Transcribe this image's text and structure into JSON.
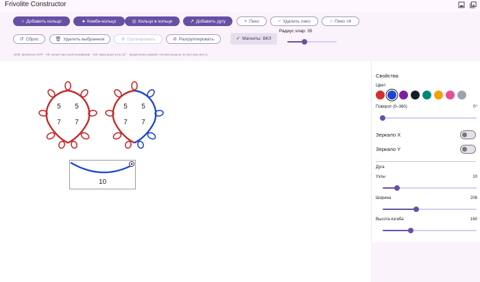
{
  "app": {
    "title": "Frivolite Constructor"
  },
  "window_icons": [
    "image-icon",
    "gallery-icon"
  ],
  "toolbar": {
    "row1": [
      {
        "id": "add-ring",
        "label": "Добавить кольцо",
        "icon": "circle-icon",
        "glyph": "○",
        "style": "filled"
      },
      {
        "id": "combo-ring",
        "label": "Комби-кольцо",
        "icon": "filled-circle-icon",
        "glyph": "●",
        "style": "filled"
      },
      {
        "id": "ring-in-ring",
        "label": "Кольцо в кольце",
        "icon": "ring-in-ring-icon",
        "glyph": "◎",
        "style": "filled"
      },
      {
        "id": "add-arc",
        "label": "Добавить дугу",
        "icon": "trend-icon",
        "glyph": "↗",
        "style": "filled"
      },
      {
        "id": "picot",
        "label": "Пико",
        "icon": "plus-icon",
        "glyph": "+",
        "style": "outlined"
      },
      {
        "id": "remove-picot",
        "label": "Удалить пико",
        "icon": "minus-icon",
        "glyph": "−",
        "style": "outlined"
      },
      {
        "id": "picot-x8",
        "label": "Пико ×8",
        "icon": "circle-clock-icon",
        "glyph": "○",
        "style": "outlined"
      }
    ],
    "row2": [
      {
        "id": "reset",
        "label": "Сброс",
        "icon": "reset-icon",
        "glyph": "↺",
        "style": "outlined"
      },
      {
        "id": "delete-selected",
        "label": "Удалить выбранное",
        "icon": "trash-icon",
        "glyph": "🗑",
        "style": "outlined"
      },
      {
        "id": "group",
        "label": "Группировать",
        "icon": "group-icon",
        "glyph": "⊕",
        "style": "disabled"
      },
      {
        "id": "ungroup",
        "label": "Разгруппировать",
        "icon": "ungroup-icon",
        "glyph": "⊘",
        "style": "outlined"
      },
      {
        "id": "magnets",
        "label": "Магниты: ВКЛ",
        "icon": "check-icon",
        "glyph": "✓",
        "style": "tonal"
      }
    ],
    "snap_label": "Радиус snap: 35",
    "snap_value": 0.35,
    "hint": "Shift: временно OFF  ·  Alt: копия при перетаскивании  ·  Ctrl: фиксация угла 15°  ·  Выделение рамкой: потяни мышью по пустому месту"
  },
  "canvas": {
    "rings": [
      {
        "id": "ring-left",
        "color": "#c62828",
        "numbers": [
          "5",
          "5",
          "7",
          "7"
        ]
      },
      {
        "id": "ring-right",
        "color": "#c62828",
        "accent": "#1e44d4",
        "numbers": [
          "5",
          "5",
          "7",
          "7"
        ]
      }
    ],
    "arc": {
      "color": "#1e44d4",
      "label": "10"
    }
  },
  "properties": {
    "title": "Свойства",
    "color_label": "Цвет",
    "colors": [
      "#d32f2f",
      "#1e44d4",
      "#7b1fa2",
      "#1a1a2e",
      "#00897b",
      "#f59e0b",
      "#ec4899",
      "#9ca3af"
    ],
    "selected_color_index": 1,
    "rotation_label": "Поворот (0–360)",
    "rotation_value": "0°",
    "rotation_fraction": 0,
    "mirror_x_label": "Зеркало X",
    "mirror_x_on": false,
    "mirror_y_label": "Зеркало Y",
    "mirror_y_on": false,
    "arc_section_label": "Дуга",
    "nodes_label": "Узлы",
    "nodes_value": "10",
    "nodes_fraction": 0.15,
    "width_label": "Ширина",
    "width_value": "206",
    "width_fraction": 0.36,
    "bend_label": "Высота изгиба",
    "bend_value": "160",
    "bend_fraction": 0.3
  }
}
